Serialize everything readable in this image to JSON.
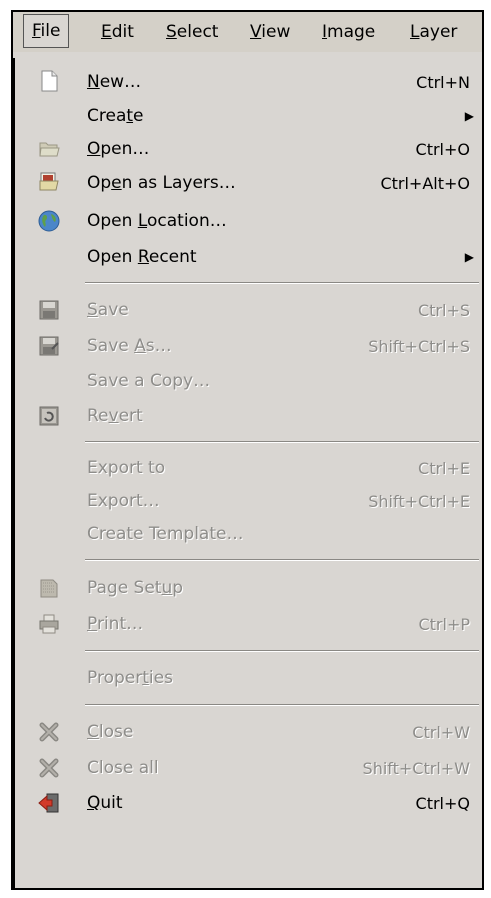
{
  "menubar": {
    "items": [
      {
        "pre": "",
        "ch": "F",
        "post": "ile"
      },
      {
        "pre": "",
        "ch": "E",
        "post": "dit"
      },
      {
        "pre": "",
        "ch": "S",
        "post": "elect"
      },
      {
        "pre": "",
        "ch": "V",
        "post": "iew"
      },
      {
        "pre": "",
        "ch": "I",
        "post": "mage"
      },
      {
        "pre": "",
        "ch": "L",
        "post": "ayer"
      }
    ]
  },
  "menu": {
    "items": [
      {
        "pre": "",
        "ch": "N",
        "post": "ew…",
        "accel": "Ctrl+N",
        "icon": "new-document-icon"
      },
      {
        "pre": "Crea",
        "ch": "t",
        "post": "e",
        "submenu": true
      },
      {
        "pre": "",
        "ch": "O",
        "post": "pen…",
        "accel": "Ctrl+O",
        "icon": "folder-open-icon"
      },
      {
        "pre": "Op",
        "ch": "e",
        "post": "n as Layers…",
        "accel": "Ctrl+Alt+O",
        "icon": "open-layers-icon"
      },
      {
        "pre": "Open ",
        "ch": "L",
        "post": "ocation…",
        "icon": "globe-icon"
      },
      {
        "pre": "Open ",
        "ch": "R",
        "post": "ecent",
        "submenu": true
      },
      {
        "pre": "",
        "ch": "S",
        "post": "ave",
        "accel": "Ctrl+S",
        "icon": "save-icon"
      },
      {
        "pre": "Save ",
        "ch": "A",
        "post": "s…",
        "accel": "Shift+Ctrl+S",
        "icon": "save-as-icon"
      },
      {
        "pre": "Save a Copy…",
        "ch": "",
        "post": ""
      },
      {
        "pre": "Re",
        "ch": "v",
        "post": "ert",
        "icon": "revert-icon"
      },
      {
        "pre": "Export to",
        "ch": "",
        "post": "",
        "accel": "Ctrl+E"
      },
      {
        "pre": "Export…",
        "ch": "",
        "post": "",
        "accel": "Shift+Ctrl+E"
      },
      {
        "pre": "Create Template…",
        "ch": "",
        "post": ""
      },
      {
        "pre": "Page Set",
        "ch": "u",
        "post": "p",
        "icon": "page-setup-icon"
      },
      {
        "pre": "",
        "ch": "P",
        "post": "rint…",
        "accel": "Ctrl+P",
        "icon": "printer-icon"
      },
      {
        "pre": "Proper",
        "ch": "t",
        "post": "ies"
      },
      {
        "pre": "",
        "ch": "C",
        "post": "lose",
        "accel": "Ctrl+W",
        "icon": "close-icon"
      },
      {
        "pre": "Close all",
        "ch": "",
        "post": "",
        "accel": "Shift+Ctrl+W",
        "icon": "close-all-icon"
      },
      {
        "pre": "",
        "ch": "Q",
        "post": "uit",
        "accel": "Ctrl+Q",
        "icon": "quit-icon"
      }
    ]
  }
}
